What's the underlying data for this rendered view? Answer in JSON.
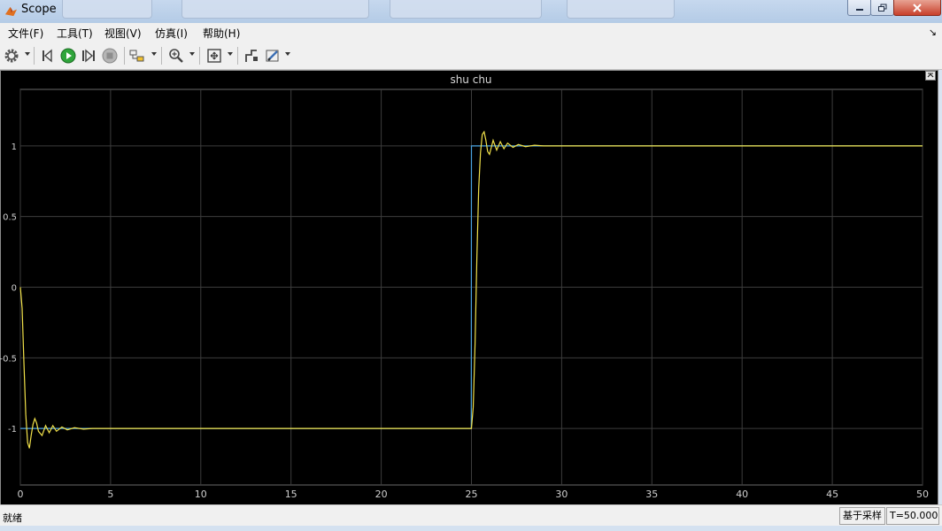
{
  "window": {
    "title": "Scope"
  },
  "menu": {
    "items": [
      {
        "label": "文件(F)"
      },
      {
        "label": "工具(T)"
      },
      {
        "label": "视图(V)"
      },
      {
        "label": "仿真(I)"
      },
      {
        "label": "帮助(H)"
      }
    ],
    "overflow_glyph": "↘"
  },
  "toolbar": {
    "icons": [
      "gear-icon",
      "step-back-icon",
      "run-icon",
      "step-forward-icon",
      "stop-icon",
      "highlight-icon",
      "zoom-icon",
      "autoscale-icon",
      "signal-icon",
      "style-icon"
    ]
  },
  "status": {
    "text": "就绪",
    "mode": "基于采样",
    "time": "T=50.000"
  },
  "colors": {
    "signal": "#f2e24a",
    "reference": "#4aa3e0",
    "grid": "#3d3d3d",
    "axis_text": "#cfcfcf"
  },
  "chart_data": {
    "type": "line",
    "title": "shu chu",
    "xlabel": "",
    "ylabel": "",
    "xlim": [
      0,
      50
    ],
    "ylim": [
      -1.4,
      1.4
    ],
    "x_ticks": [
      0,
      5,
      10,
      15,
      20,
      25,
      30,
      35,
      40,
      45,
      50
    ],
    "y_ticks": [
      -1,
      -0.5,
      0,
      0.5,
      1
    ],
    "y_tick_labels": [
      "-1",
      "-0.5",
      "0",
      "0.5",
      "1"
    ],
    "grid": true,
    "series": [
      {
        "x": [
          0,
          0.1,
          0.2,
          0.3,
          0.4,
          0.5,
          0.6,
          0.7,
          0.8,
          0.9,
          1.0,
          1.2,
          1.4,
          1.6,
          1.8,
          2.0,
          2.3,
          2.6,
          3.0,
          3.5,
          4.0,
          5.0,
          25.0,
          25.1,
          25.2,
          25.3,
          25.4,
          25.5,
          25.6,
          25.7,
          25.8,
          25.9,
          26.0,
          26.2,
          26.4,
          26.6,
          26.8,
          27.0,
          27.3,
          27.6,
          28.0,
          28.5,
          29.0,
          50.0
        ],
        "y": [
          0,
          -0.15,
          -0.55,
          -0.9,
          -1.1,
          -1.14,
          -1.05,
          -0.97,
          -0.93,
          -0.96,
          -1.02,
          -1.05,
          -0.98,
          -1.03,
          -0.98,
          -1.02,
          -0.99,
          -1.01,
          -0.995,
          -1.005,
          -1.0,
          -1.0,
          -1.0,
          -0.85,
          -0.4,
          0.2,
          0.7,
          0.95,
          1.08,
          1.1,
          1.04,
          0.96,
          0.94,
          1.04,
          0.97,
          1.03,
          0.98,
          1.02,
          0.99,
          1.01,
          0.995,
          1.005,
          1.0,
          1.0
        ]
      },
      {
        "x": [
          0,
          24.99,
          25.0,
          50
        ],
        "y": [
          -1,
          -1,
          1,
          1
        ]
      }
    ]
  }
}
